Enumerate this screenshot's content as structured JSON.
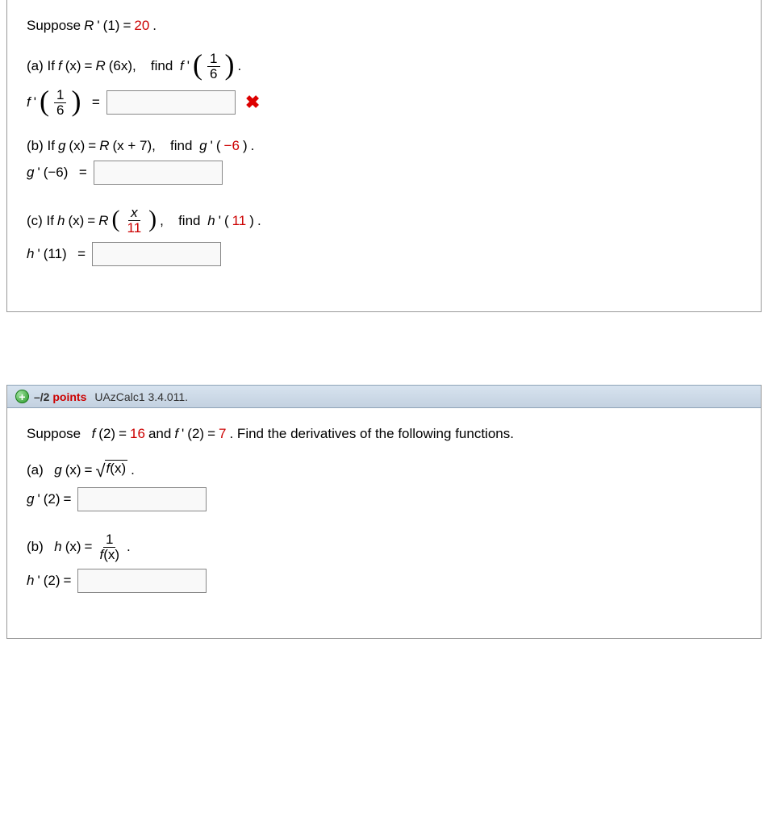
{
  "q1": {
    "given": {
      "prefix": "Suppose ",
      "func": "R ",
      "prime": "'",
      "arg": "(1)",
      "eq": " = ",
      "value": "20",
      "dot": "."
    },
    "parts": {
      "a": {
        "label": "(a) If  ",
        "func_def_lhs_f": "f",
        "func_def_lhs_x": "(x)",
        "eq": " = ",
        "func_def_rhs_R": "R",
        "func_def_rhs_arg": "(6x),",
        "find": "   find ",
        "f": "f ",
        "prime": "'",
        "frac_num": "1",
        "frac_den": "6",
        "dot": ".",
        "answer_lhs_f": "f ",
        "answer_lhs_prime": "'",
        "answer_eq": "  =",
        "input_value": "",
        "wrong": "✖"
      },
      "b": {
        "label": "(b) If  ",
        "g": "g",
        "x": "(x)",
        "eq": " = ",
        "R": "R",
        "arg": "(x + 7),",
        "find": "   find ",
        "gp": "g ",
        "prime": "'",
        "argv": "(",
        "neg6": "−6",
        "close": ")",
        "dot": " .",
        "answer_g": "g ",
        "answer_prime": "'",
        "answer_arg": "(−6)",
        "answer_eq": "  =",
        "input_value": ""
      },
      "c": {
        "label": "(c) If  ",
        "h": "h",
        "x": "(x)",
        "eq": " = ",
        "R": "R",
        "frac_num": "x",
        "frac_den": "11",
        "comma": ",",
        "find": "   find ",
        "hp": "h ",
        "prime": "' ",
        "argv": "(",
        "eleven": "11",
        "close": ")",
        "dot": " .",
        "answer_h": "h ",
        "answer_prime": "' ",
        "answer_arg": "(11)",
        "answer_eq": "  =",
        "input_value": ""
      }
    }
  },
  "q2": {
    "header": {
      "score": "–/2",
      "points_label": " points",
      "source": "UAzCalc1 3.4.011."
    },
    "given": {
      "prefix": "Suppose  ",
      "f": "f",
      "arg2": "(2)",
      "eq1": " = ",
      "val1": "16",
      "and": " and ",
      "fp": "f ",
      "prime": "'",
      "arg2b": "(2)",
      "eq2": " = ",
      "val2": "7",
      "rest": " . Find the derivatives of the following functions."
    },
    "parts": {
      "a": {
        "label": "(a)  ",
        "g": "g",
        "x": "(x)",
        "eq": " = ",
        "sqrt_body_f": "f",
        "sqrt_body_x": "(x)",
        "dot": " .",
        "answer_g": "g ",
        "answer_prime": "'",
        "answer_arg": "(2)",
        "answer_eq": " =",
        "input_value": ""
      },
      "b": {
        "label": "(b)  ",
        "h": "h",
        "x": "(x)",
        "eq": " = ",
        "frac_num": "1",
        "frac_den_f": "f",
        "frac_den_x": "(x)",
        "dot": " .",
        "answer_h": "h ",
        "answer_prime": "'",
        "answer_arg": "(2)",
        "answer_eq": " =",
        "input_value": ""
      }
    }
  }
}
